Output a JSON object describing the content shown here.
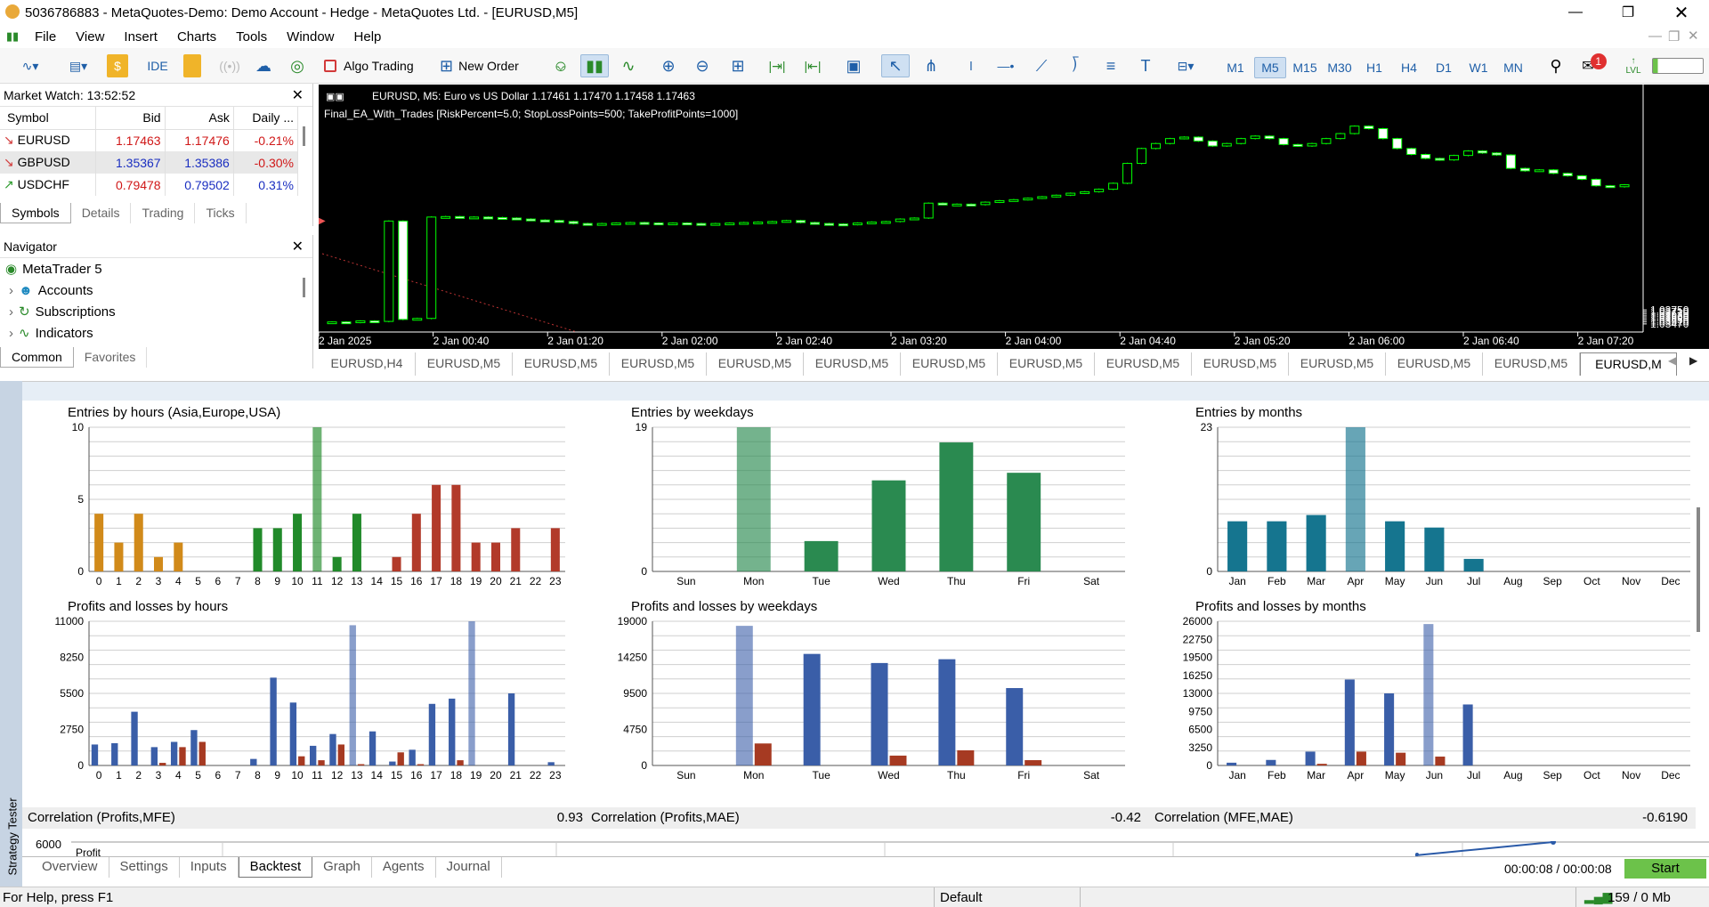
{
  "window": {
    "title": "5036786883 - MetaQuotes-Demo: Demo Account - Hedge - MetaQuotes Ltd. - [EURUSD,M5]"
  },
  "menu": [
    "File",
    "View",
    "Insert",
    "Charts",
    "Tools",
    "Window",
    "Help"
  ],
  "toolbar": {
    "ide": "IDE",
    "algo": "Algo Trading",
    "new_order": "New Order",
    "timeframes": [
      "M1",
      "M5",
      "M15",
      "M30",
      "H1",
      "H4",
      "D1",
      "W1",
      "MN"
    ],
    "active_tf": "M5",
    "notif_count": "1",
    "lvl": "LVL"
  },
  "market_watch": {
    "title": "Market Watch: 13:52:52",
    "columns": [
      "Symbol",
      "Bid",
      "Ask",
      "Daily ..."
    ],
    "rows": [
      {
        "symbol": "EURUSD",
        "bid": "1.17463",
        "ask": "1.17476",
        "daily": "-0.21%"
      },
      {
        "symbol": "GBPUSD",
        "bid": "1.35367",
        "ask": "1.35386",
        "daily": "-0.30%"
      },
      {
        "symbol": "USDCHF",
        "bid": "0.79478",
        "ask": "0.79502",
        "daily": "0.31%"
      }
    ],
    "tabs": [
      "Symbols",
      "Details",
      "Trading",
      "Ticks"
    ]
  },
  "navigator": {
    "title": "Navigator",
    "items": [
      "MetaTrader 5",
      "Accounts",
      "Subscriptions",
      "Indicators"
    ],
    "tabs": [
      "Common",
      "Favorites"
    ]
  },
  "chart": {
    "header": "EURUSD, M5:  Euro vs US Dollar  1.17461 1.17470 1.17458 1.17463",
    "ea": "Final_EA_With_Trades [RiskPercent=5.0; StopLossPoints=500; TakeProfitPoints=1000]",
    "price_labels": [
      "1.03750",
      "1.03710",
      "1.03670",
      "1.03630",
      "1.03590",
      "1.03550",
      "1.03510",
      "1.03470"
    ],
    "time_labels": [
      "2 Jan 2025",
      "2 Jan 00:40",
      "2 Jan 01:20",
      "2 Jan 02:00",
      "2 Jan 02:40",
      "2 Jan 03:20",
      "2 Jan 04:00",
      "2 Jan 04:40",
      "2 Jan 05:20",
      "2 Jan 06:00",
      "2 Jan 06:40",
      "2 Jan 07:20"
    ],
    "closes": [
      1.0351,
      1.035,
      1.0353,
      1.0352,
      1.0554,
      1.0356,
      1.0358,
      1.0562,
      1.0563,
      1.0562,
      1.0562,
      1.0561,
      1.056,
      1.0558,
      1.0556,
      1.0555,
      1.0553,
      1.0549,
      1.0548,
      1.0549,
      1.055,
      1.0551,
      1.055,
      1.0549,
      1.055,
      1.0549,
      1.0548,
      1.0549,
      1.055,
      1.0551,
      1.0552,
      1.0553,
      1.0555,
      1.0551,
      1.0549,
      1.0548,
      1.0547,
      1.055,
      1.0552,
      1.0553,
      1.0558,
      1.056,
      1.059,
      1.0588,
      1.0588,
      1.0587,
      1.0592,
      1.0595,
      1.0597,
      1.06,
      1.0603,
      1.0606,
      1.061,
      1.0613,
      1.0618,
      1.063,
      1.067,
      1.07,
      1.071,
      1.072,
      1.0723,
      1.0715,
      1.0705,
      1.071,
      1.072,
      1.0725,
      1.072,
      1.0708,
      1.0705,
      1.071,
      1.072,
      1.073,
      1.0745,
      1.074,
      1.072,
      1.07,
      1.0688,
      1.068,
      1.0677,
      1.0686,
      1.0695,
      1.0691,
      1.0687,
      1.066,
      1.0655,
      1.0657,
      1.065,
      1.0645,
      1.0638,
      1.0625,
      1.0623,
      1.0627
    ],
    "tabs": [
      "EURUSD,H4",
      "EURUSD,M5",
      "EURUSD,M5",
      "EURUSD,M5",
      "EURUSD,M5",
      "EURUSD,M5",
      "EURUSD,M5",
      "EURUSD,M5",
      "EURUSD,M5",
      "EURUSD,M5",
      "EURUSD,M5",
      "EURUSD,M5",
      "EURUSD,M5",
      "EURUSD,M"
    ]
  },
  "chart_data": [
    {
      "type": "bar",
      "title": "Entries by hours (Asia,Europe,USA)",
      "categories": [
        "0",
        "1",
        "2",
        "3",
        "4",
        "5",
        "6",
        "7",
        "8",
        "9",
        "10",
        "11",
        "12",
        "13",
        "14",
        "15",
        "16",
        "17",
        "18",
        "19",
        "20",
        "21",
        "22",
        "23"
      ],
      "values": [
        4,
        2,
        4,
        1,
        2,
        0,
        0,
        0,
        3,
        3,
        4,
        10,
        1,
        4,
        0,
        1,
        4,
        6,
        6,
        2,
        2,
        3,
        0,
        3
      ],
      "ylim": [
        0,
        10
      ],
      "ticks": [
        "10",
        "5",
        "0"
      ]
    },
    {
      "type": "bar",
      "title": "Entries by weekdays",
      "categories": [
        "Sun",
        "Mon",
        "Tue",
        "Wed",
        "Thu",
        "Fri",
        "Sat"
      ],
      "values": [
        0,
        19,
        4,
        12,
        17,
        13,
        0
      ],
      "ylim": [
        0,
        19
      ],
      "ticks": [
        "19",
        "0"
      ]
    },
    {
      "type": "bar",
      "title": "Entries by months",
      "categories": [
        "Jan",
        "Feb",
        "Mar",
        "Apr",
        "May",
        "Jun",
        "Jul",
        "Aug",
        "Sep",
        "Oct",
        "Nov",
        "Dec"
      ],
      "values": [
        8,
        8,
        9,
        23,
        8,
        7,
        2,
        0,
        0,
        0,
        0,
        0
      ],
      "ylim": [
        0,
        23
      ],
      "ticks": [
        "23",
        "0"
      ]
    },
    {
      "type": "bar",
      "title": "Profits and losses by hours",
      "categories": [
        "0",
        "1",
        "2",
        "3",
        "4",
        "5",
        "6",
        "7",
        "8",
        "9",
        "10",
        "11",
        "12",
        "13",
        "14",
        "15",
        "16",
        "17",
        "18",
        "19",
        "20",
        "21",
        "22",
        "23"
      ],
      "series": [
        {
          "values": [
            1600,
            1700,
            4100,
            1400,
            1800,
            2700,
            0,
            0,
            500,
            6700,
            4800,
            1500,
            2400,
            10700,
            2600,
            300,
            1200,
            4700,
            5100,
            11000,
            0,
            5500,
            0,
            250
          ]
        },
        {
          "values": [
            0,
            0,
            0,
            200,
            1400,
            1800,
            0,
            0,
            0,
            0,
            700,
            400,
            1600,
            100,
            0,
            1000,
            100,
            0,
            400,
            0,
            0,
            0,
            0,
            0
          ]
        }
      ],
      "ylim": [
        0,
        11000
      ],
      "ticks": [
        "11000",
        "8250",
        "5500",
        "2750",
        "0"
      ]
    },
    {
      "type": "bar",
      "title": "Profits and losses by weekdays",
      "categories": [
        "Sun",
        "Mon",
        "Tue",
        "Wed",
        "Thu",
        "Fri",
        "Sat"
      ],
      "series": [
        {
          "values": [
            0,
            18400,
            14700,
            13500,
            14000,
            10200,
            0
          ]
        },
        {
          "values": [
            0,
            2900,
            0,
            1300,
            2000,
            700,
            0
          ]
        }
      ],
      "ylim": [
        0,
        19000
      ],
      "ticks": [
        "19000",
        "14250",
        "9500",
        "4750",
        "0"
      ]
    },
    {
      "type": "bar",
      "title": "Profits and losses by months",
      "categories": [
        "Jan",
        "Feb",
        "Mar",
        "Apr",
        "May",
        "Jun",
        "Jul",
        "Aug",
        "Sep",
        "Oct",
        "Nov",
        "Dec"
      ],
      "series": [
        {
          "values": [
            500,
            1000,
            2500,
            15500,
            13000,
            25500,
            11000,
            0,
            0,
            0,
            0,
            0
          ]
        },
        {
          "values": [
            0,
            0,
            300,
            2500,
            2300,
            1600,
            0,
            0,
            0,
            0,
            0,
            0
          ]
        }
      ],
      "ylim": [
        0,
        26000
      ],
      "ticks": [
        "26000",
        "22750",
        "19500",
        "16250",
        "13000",
        "9750",
        "6500",
        "3250",
        "0"
      ]
    }
  ],
  "correlation": [
    {
      "label": "Correlation (Profits,MFE)",
      "value": "0.93"
    },
    {
      "label": "Correlation (Profits,MAE)",
      "value": "-0.42"
    },
    {
      "label": "Correlation (MFE,MAE)",
      "value": "-0.6190"
    }
  ],
  "bottom_chart": {
    "ytick": "6000",
    "label": "Profit"
  },
  "tester": {
    "side_label": "Strategy Tester",
    "tabs": [
      "Overview",
      "Settings",
      "Inputs",
      "Backtest",
      "Graph",
      "Agents",
      "Journal"
    ],
    "active_tab": "Backtest",
    "timer": "00:00:08 / 00:00:08",
    "start": "Start"
  },
  "status": {
    "help": "For Help, press F1",
    "profile": "Default",
    "traffic": "159 / 0 Mb"
  },
  "colors": {
    "up_candle": "#00ff00",
    "bar_orange": "#d18a1a",
    "bar_green": "#218a2a",
    "bar_red": "#b23a2a",
    "bar_teal": "#1f85a0",
    "bar_blue": "#3a5ea8",
    "bar_loss": "#a63a22",
    "start_btn": "#6cc24a"
  }
}
